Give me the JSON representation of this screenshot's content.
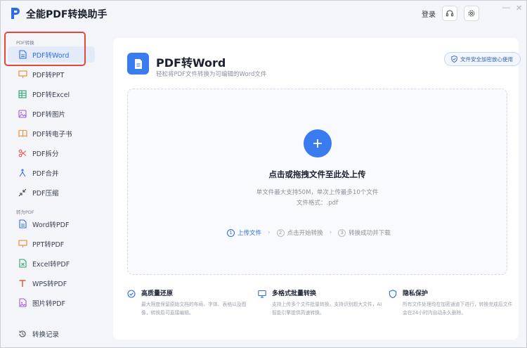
{
  "app": {
    "title": "全能PDF转换助手",
    "login_label": "登录"
  },
  "colors": {
    "accent": "#3b7bf0",
    "highlight_box": "#e14a3b"
  },
  "sidebar": {
    "section1": "PDF转换",
    "section2": "转为PDF",
    "items": [
      {
        "label": "PDF转Word",
        "icon": "doc-icon",
        "active": true
      },
      {
        "label": "PDF转PPT",
        "icon": "presentation-icon"
      },
      {
        "label": "PDF转Excel",
        "icon": "sheet-icon"
      },
      {
        "label": "PDF转图片",
        "icon": "image-icon"
      },
      {
        "label": "PDF转电子书",
        "icon": "book-icon"
      },
      {
        "label": "PDF拆分",
        "icon": "scissors-icon"
      },
      {
        "label": "PDF合并",
        "icon": "merge-icon"
      },
      {
        "label": "PDF压缩",
        "icon": "compress-icon"
      },
      {
        "label": "Word转PDF",
        "icon": "word-icon"
      },
      {
        "label": "PPT转PDF",
        "icon": "ppt-icon"
      },
      {
        "label": "Excel转PDF",
        "icon": "excel-icon"
      },
      {
        "label": "WPS转PDF",
        "icon": "wps-icon"
      },
      {
        "label": "图片转PDF",
        "icon": "image-pdf-icon"
      }
    ],
    "history_label": "转换记录"
  },
  "main": {
    "title": "PDF转Word",
    "subtitle": "轻松将PDF文件转换为可编辑的Word文件",
    "secure_badge": "文件安全加密放心使用",
    "drop": {
      "title": "点击或拖拽文件至此处上传",
      "line1": "单文件最大支持50M，单次上传最多10个文件",
      "line2": "文件格式：.pdf"
    },
    "steps": [
      {
        "num": "1",
        "label": "上传文件"
      },
      {
        "num": "2",
        "label": "点击开始转换"
      },
      {
        "num": "3",
        "label": "转换成功并下载"
      }
    ],
    "features": [
      {
        "title": "高质量还原",
        "desc": "最大限度保留原始文档的布局、字体、表格以及图像，转换后可直接编辑。"
      },
      {
        "title": "多格式批量转换",
        "desc": "支持上传多个文件批量转换，支持识别超大文件，AI智能引擎提供高速转换。"
      },
      {
        "title": "隐私保护",
        "desc": "所有文件处理均在加密通道下进行，转换完成后文件会在24小时内自动永久删除。"
      }
    ]
  }
}
